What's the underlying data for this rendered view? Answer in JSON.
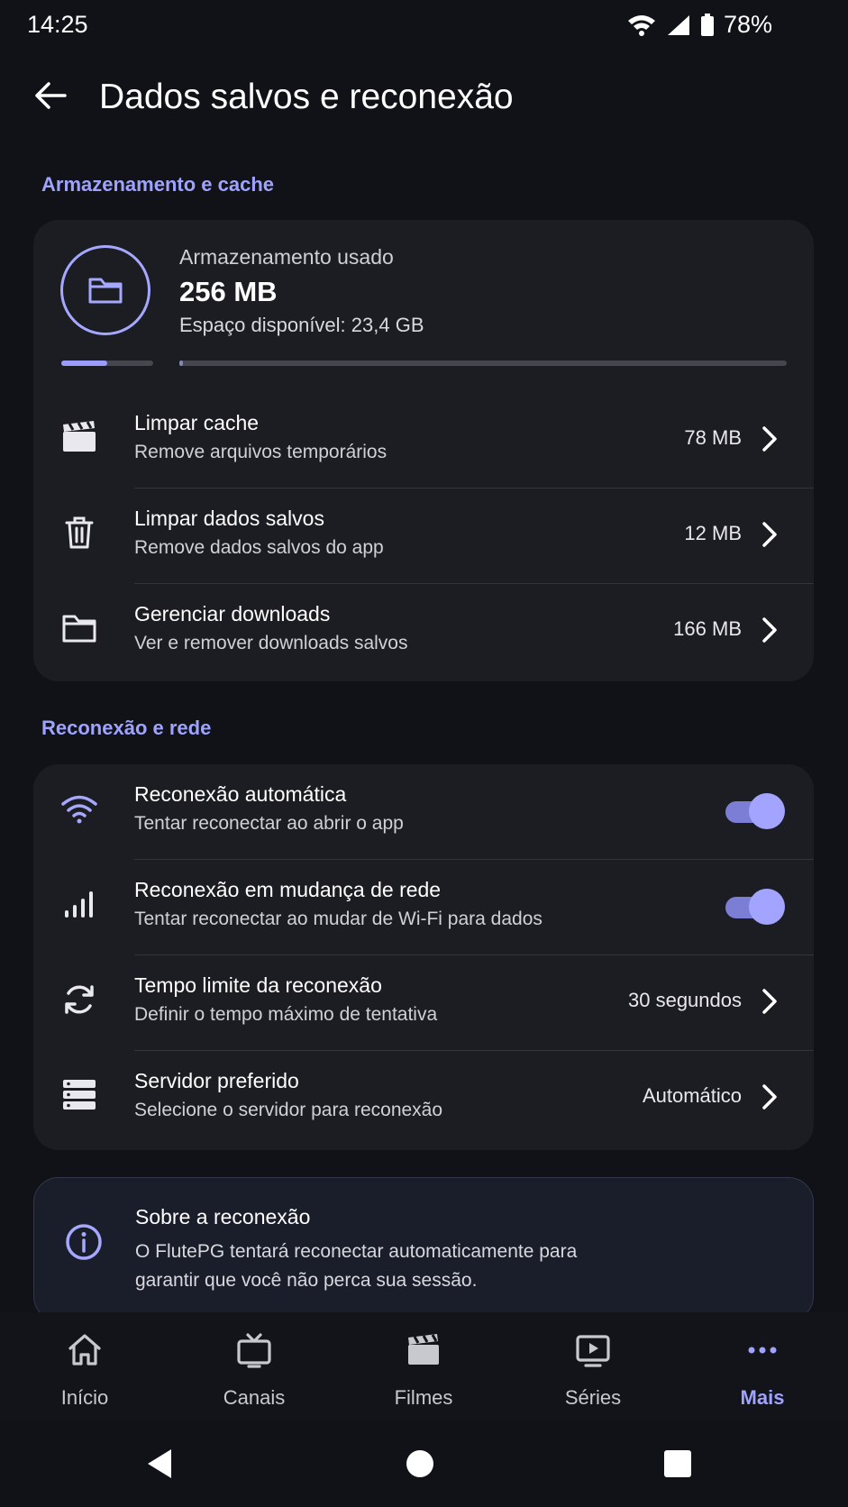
{
  "status_bar": {
    "time": "14:25",
    "battery": "78%"
  },
  "header": {
    "title": "Dados salvos e reconexão"
  },
  "storage_section": {
    "label": "Armazenamento e cache",
    "title": "Armazenamento usado",
    "used": "256 MB",
    "available": "Espaço disponível: 23,4 GB",
    "usage_fraction": 0.5,
    "rows": [
      {
        "title": "Limpar cache",
        "subtitle": "Remove arquivos temporários",
        "value": "78 MB",
        "icon": "clapperboard-icon"
      },
      {
        "title": "Limpar dados salvos",
        "subtitle": "Remove dados salvos do app",
        "value": "12 MB",
        "icon": "trash-icon"
      },
      {
        "title": "Gerenciar downloads",
        "subtitle": "Ver e remover downloads salvos",
        "value": "166 MB",
        "icon": "folder-icon"
      }
    ]
  },
  "network_section": {
    "label": "Reconexão e rede",
    "rows": [
      {
        "title": "Reconexão automática",
        "subtitle": "Tentar reconectar ao abrir o app",
        "toggle": true,
        "icon": "wifi-icon"
      },
      {
        "title": "Reconexão em mudança de rede",
        "subtitle": "Tentar reconectar ao mudar de Wi-Fi para dados",
        "toggle": true,
        "icon": "signal-bars-icon"
      },
      {
        "title": "Tempo limite da reconexão",
        "subtitle": "Definir o tempo máximo de tentativa",
        "value": "30 segundos",
        "icon": "refresh-icon"
      },
      {
        "title": "Servidor preferido",
        "subtitle": "Selecione o servidor para reconexão",
        "value": "Automático",
        "icon": "server-icon"
      }
    ]
  },
  "info": {
    "title": "Sobre a reconexão",
    "text": "O FlutePG tentará reconectar automaticamente para garantir que você não perca sua sessão."
  },
  "bottom_nav": [
    {
      "label": "Início",
      "icon": "home-icon"
    },
    {
      "label": "Canais",
      "icon": "tv-icon"
    },
    {
      "label": "Filmes",
      "icon": "clapperboard-icon"
    },
    {
      "label": "Séries",
      "icon": "play-screen-icon"
    },
    {
      "label": "Mais",
      "icon": "more-icon",
      "active": true
    }
  ],
  "colors": {
    "accent": "#9fa3ff",
    "background": "#101217",
    "card": "#1c1d22"
  }
}
